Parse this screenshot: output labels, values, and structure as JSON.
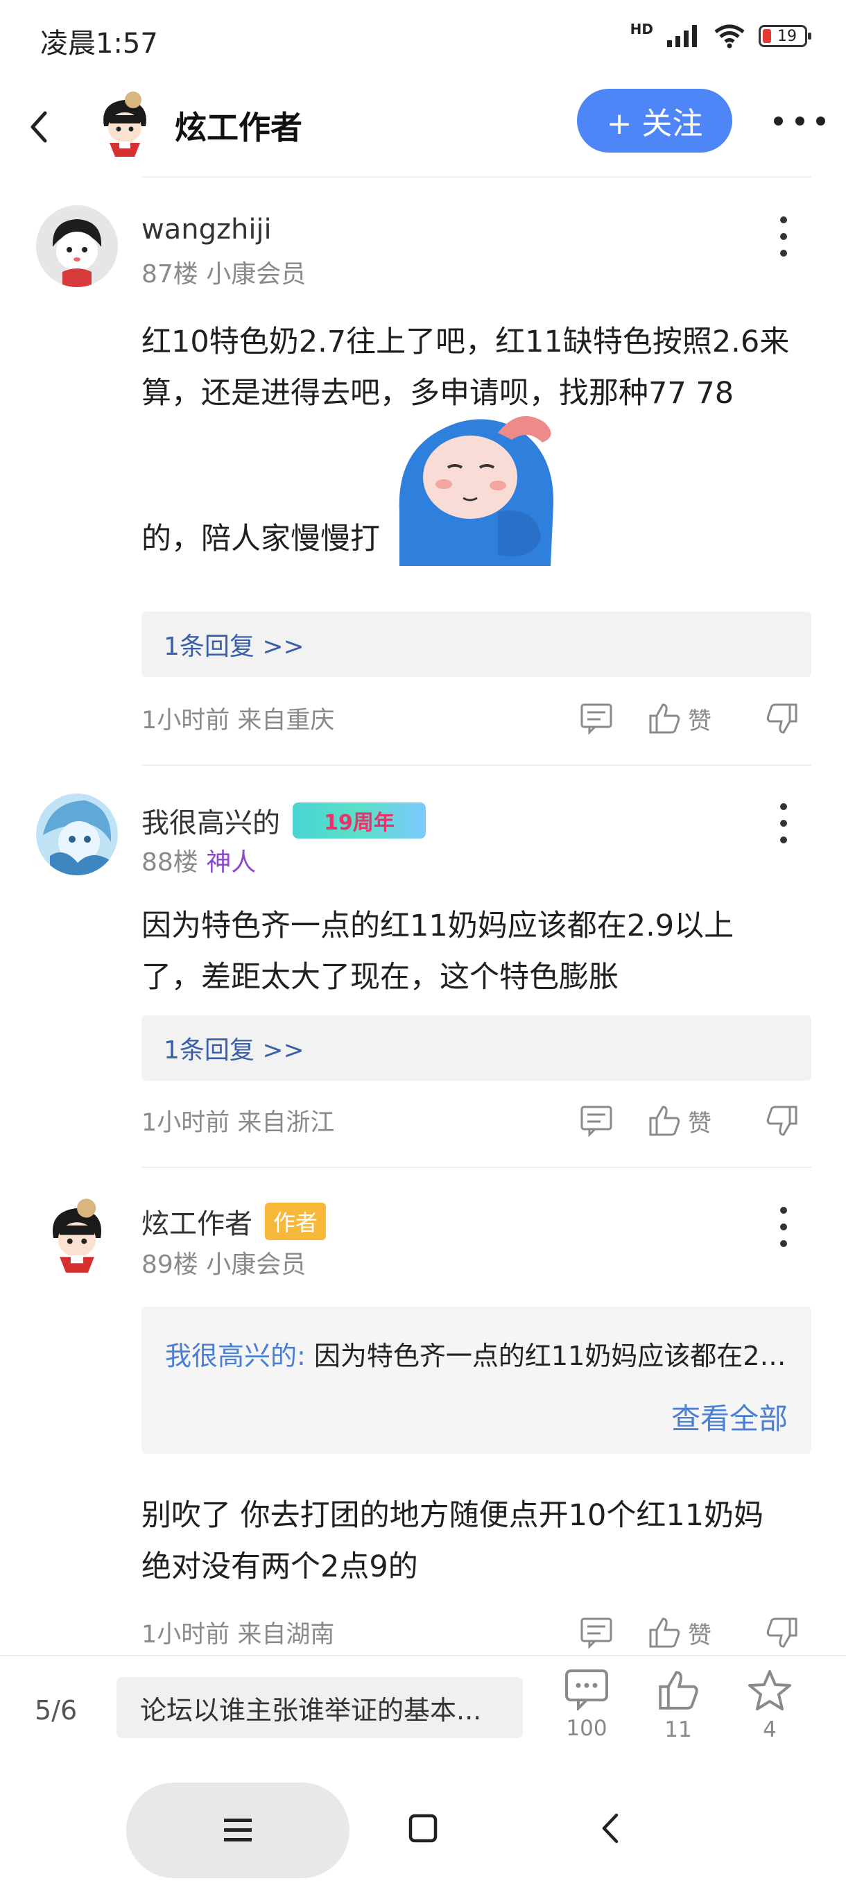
{
  "status": {
    "time": "凌晨1:57",
    "battery": "19",
    "network_label": "HD"
  },
  "header": {
    "title": "炫工作者",
    "follow_label": "+ 关注"
  },
  "posts": [
    {
      "author": "wangzhiji",
      "floor": "87楼",
      "level": "小康会员",
      "content_line1": "红10特色奶2.7往上了吧，红11缺特色按照2.6来",
      "content_line2": "算，还是进得去吧，多申请呗，找那种77 78",
      "content_line3": "的，陪人家慢慢打",
      "reply_link": "1条回复 >>",
      "time": "1小时前",
      "location": "来自重庆",
      "like_label": "赞"
    },
    {
      "author": "我很高兴的",
      "badge": "19周年",
      "floor": "88楼",
      "level": "神人",
      "content_line1": "因为特色齐一点的红11奶妈应该都在2.9以上",
      "content_line2": "了，差距太大了现在，这个特色膨胀",
      "reply_link": "1条回复 >>",
      "time": "1小时前",
      "location": "来自浙江",
      "like_label": "赞"
    },
    {
      "author": "炫工作者",
      "badge": "作者",
      "floor": "89楼",
      "level": "小康会员",
      "quote_author": "我很高兴的:",
      "quote_text": " 因为特色齐一点的红11奶妈应该都在2....",
      "quote_more": "查看全部",
      "content_line1": "别吹了 你去打团的地方随便点开10个红11奶妈",
      "content_line2": "绝对没有两个2点9的",
      "time": "1小时前",
      "location": "来自湖南",
      "like_label": "赞"
    }
  ],
  "bottom_bar": {
    "page_indicator": "5/6",
    "reply_preview": "论坛以谁主张谁举证的基本...",
    "comment_count": "100",
    "like_count": "11",
    "fav_count": "4"
  },
  "colors": {
    "accent": "#4f86f7",
    "link": "#4a7fd3",
    "author_badge": "#f8b93b"
  }
}
